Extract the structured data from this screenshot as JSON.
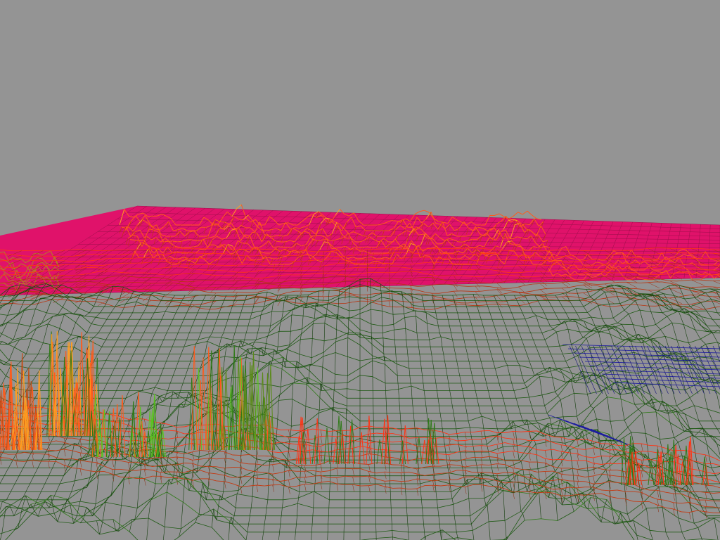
{
  "scene": {
    "background_color": "#949494",
    "render_mode": "wireframe",
    "palette": {
      "far_plane": "#e0126a",
      "peaks_orange": "#ff5a1a",
      "peaks_yellow": "#ff9d20",
      "ridge_red": "#ff3414",
      "valley_green": "#1f5a14",
      "bright_green": "#5bc41f",
      "water_blue": "#1a1aa0",
      "outline_dark": "#1a1a1a"
    }
  }
}
